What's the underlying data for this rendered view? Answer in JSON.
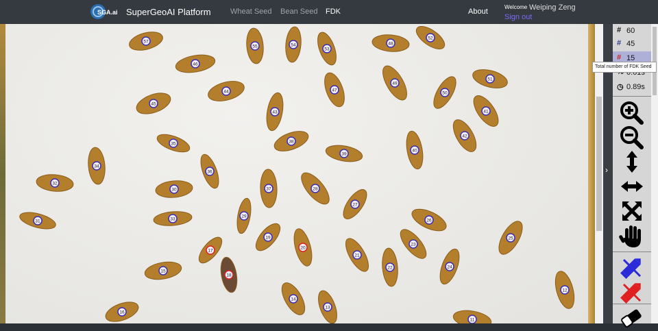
{
  "nav": {
    "brand": "SuperGeoAI Platform",
    "logo_text": "SGA.ai",
    "links": [
      "Wheat Seed",
      "Bean Seed",
      "FDK"
    ],
    "about": "About",
    "welcome": "Welcome",
    "user": "Weiping Zeng",
    "signout": "Sign out"
  },
  "stats": [
    {
      "icon": "hash-icon",
      "glyph": "#",
      "value": "60"
    },
    {
      "icon": "hash-icon",
      "glyph": "#",
      "value": "45"
    },
    {
      "icon": "hash-icon",
      "glyph": "#",
      "value": "15"
    },
    {
      "icon": "percent-icon",
      "glyph": "%",
      "value": "0.61s"
    },
    {
      "icon": "clock-icon",
      "glyph": "◷",
      "value": "0.89s"
    }
  ],
  "tooltip": "Total number of FDK Seed",
  "tools": [
    "zoom-in",
    "zoom-out",
    "fit-height",
    "fit-width",
    "fit-all",
    "pan",
    "mark-good",
    "mark-fdk",
    "eraser"
  ],
  "seeds": [
    {
      "n": "57",
      "fdk": false
    },
    {
      "n": "46",
      "fdk": false
    },
    {
      "n": "45",
      "fdk": false
    },
    {
      "n": "44",
      "fdk": false
    },
    {
      "n": "55",
      "fdk": false
    },
    {
      "n": "54",
      "fdk": false
    },
    {
      "n": "53",
      "fdk": false
    },
    {
      "n": "48",
      "fdk": false
    },
    {
      "n": "52",
      "fdk": false
    },
    {
      "n": "47",
      "fdk": false
    },
    {
      "n": "49",
      "fdk": false
    },
    {
      "n": "50",
      "fdk": false
    },
    {
      "n": "51",
      "fdk": false
    },
    {
      "n": "41",
      "fdk": false
    },
    {
      "n": "43",
      "fdk": false
    },
    {
      "n": "38",
      "fdk": false
    },
    {
      "n": "39",
      "fdk": false
    },
    {
      "n": "40",
      "fdk": false
    },
    {
      "n": "42",
      "fdk": false
    },
    {
      "n": "35",
      "fdk": false
    },
    {
      "n": "36",
      "fdk": false
    },
    {
      "n": "34",
      "fdk": false
    },
    {
      "n": "32",
      "fdk": false
    },
    {
      "n": "30",
      "fdk": false
    },
    {
      "n": "37",
      "fdk": false
    },
    {
      "n": "28",
      "fdk": false
    },
    {
      "n": "27",
      "fdk": false
    },
    {
      "n": "26",
      "fdk": false
    },
    {
      "n": "33",
      "fdk": false
    },
    {
      "n": "31",
      "fdk": false
    },
    {
      "n": "29",
      "fdk": false
    },
    {
      "n": "19",
      "fdk": false
    },
    {
      "n": "20",
      "fdk": true
    },
    {
      "n": "21",
      "fdk": false
    },
    {
      "n": "23",
      "fdk": false
    },
    {
      "n": "22",
      "fdk": false
    },
    {
      "n": "24",
      "fdk": false
    },
    {
      "n": "25",
      "fdk": false
    },
    {
      "n": "17",
      "fdk": true
    },
    {
      "n": "18",
      "fdk": true
    },
    {
      "n": "15",
      "fdk": false
    },
    {
      "n": "14",
      "fdk": false
    },
    {
      "n": "13",
      "fdk": false
    },
    {
      "n": "12",
      "fdk": false
    },
    {
      "n": "11",
      "fdk": false
    },
    {
      "n": "16",
      "fdk": false
    }
  ]
}
